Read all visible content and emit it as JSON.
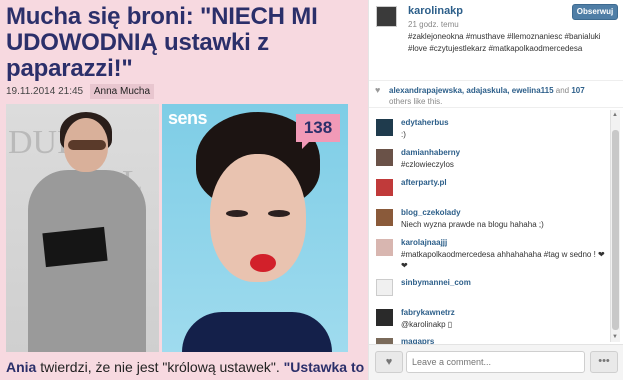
{
  "article": {
    "headline": "Mucha się broni: \"NIECH MI UDOWODNIĄ ustawki z paparazzi!\"",
    "date": "19.11.2014 21:45",
    "author": "Anna Mucha",
    "photo_logo": "sens",
    "comment_count": "138",
    "teaser_bold1": "Ania",
    "teaser_mid": " twierdzi, że nie jest \"królową ustawek\". ",
    "teaser_bold2": "\"Ustawka to"
  },
  "post": {
    "username": "karolinakp",
    "time": "21 godz. temu",
    "follow_label": "Obserwuj",
    "caption": "#zaklejoneokna #musthave #llemoznaniesc #banialuki #love #czytujestlekarz #matkapolkaodmercedesa",
    "likes_names": "alexandrapajewska, adajaskula, ewelina115",
    "likes_and": " and ",
    "likes_count": "107",
    "likes_suffix": "others like this."
  },
  "comments": [
    {
      "user": "edytaherbus",
      "text": ":)"
    },
    {
      "user": "damianhaberny",
      "text": "#czlowieczylos"
    },
    {
      "user": "afterparty.pl",
      "text": ""
    },
    {
      "user": "blog_czekolady",
      "text": "Niech wyzna prawde na blogu hahaha ;)"
    },
    {
      "user": "karolajnaajjj",
      "text": "#matkapolkaodmercedesa ahhahahaha #tag w sedno ! ❤❤"
    },
    {
      "user": "sinbymannei_com",
      "text": ""
    },
    {
      "user": "fabrykawnetrz",
      "text": "@karolinakp ▯"
    },
    {
      "user": "magaprs",
      "text": ""
    }
  ],
  "comment_input": {
    "placeholder": "Leave a comment..."
  },
  "icons": {
    "like": "heart-icon",
    "more": "more-icon"
  },
  "colors": {
    "link": "#2d5f8a",
    "follow_button": "#4f7ea6",
    "headline": "#2b2f6a",
    "badge": "#f19ab7"
  }
}
